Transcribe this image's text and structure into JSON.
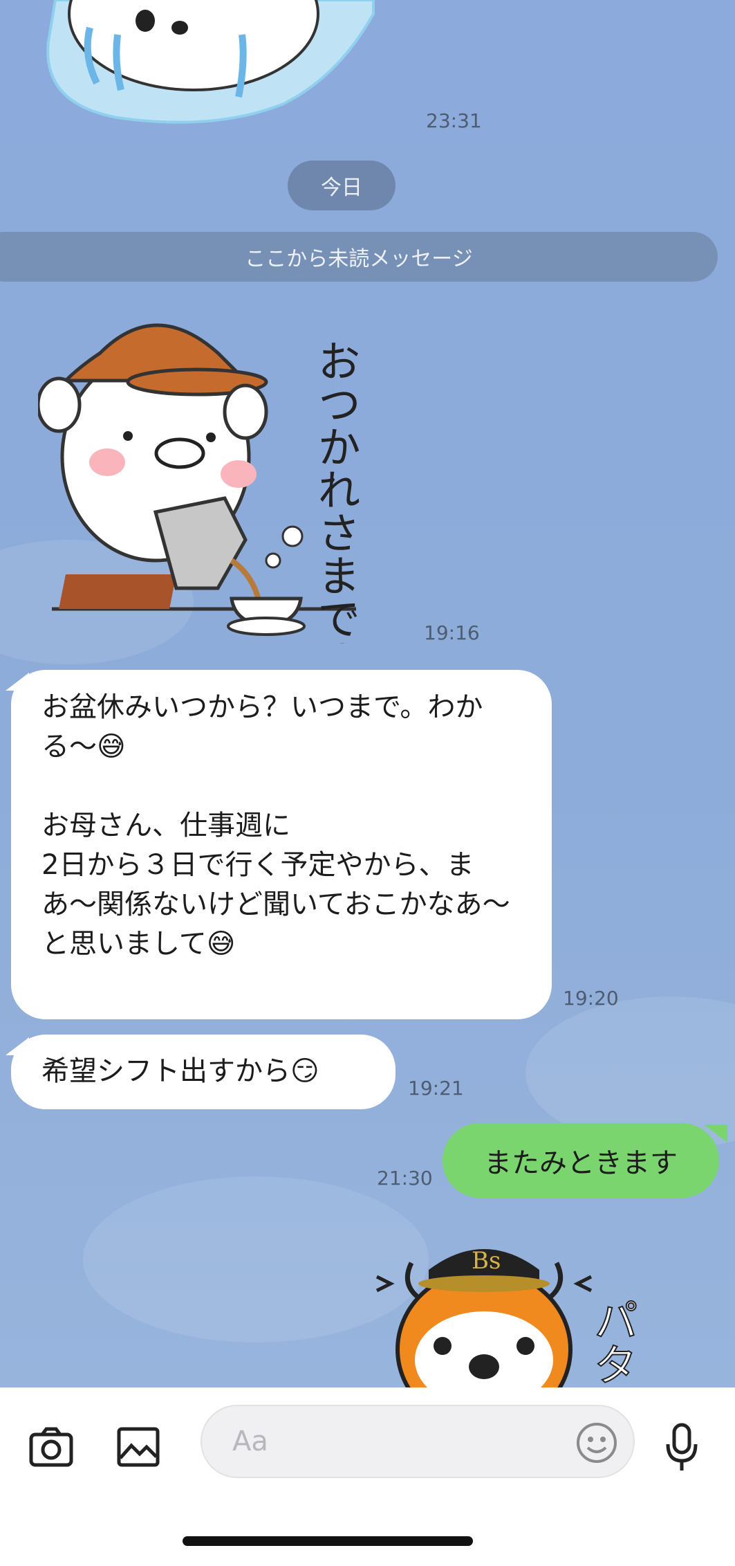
{
  "chat": {
    "top_time": "23:31",
    "date_divider": "今日",
    "unread_divider": "ここから未読メッセージ",
    "messages": [
      {
        "type": "sticker",
        "time": "19:16"
      },
      {
        "type": "text",
        "time": "19:20",
        "text": "お盆休みいつから？いつまで。わかる〜😅\n\nお母さん、仕事週に\n2日から３日で行く予定やから、まあ〜関係ないけど聞いておこかなあ〜と思いまして😅"
      },
      {
        "type": "text",
        "time": "19:21",
        "text": "希望シフト出すから😏"
      },
      {
        "type": "text",
        "time": "21:30",
        "text": "またみときます"
      },
      {
        "type": "sticker"
      }
    ],
    "sticker_text": {
      "otsukare": "おつかれさまです",
      "pata": "パタ",
      "cap": "Bs"
    }
  },
  "input_bar": {
    "placeholder": "Aa",
    "icons": [
      "camera-icon",
      "image-icon",
      "emoji-icon",
      "microphone-icon"
    ]
  },
  "colors": {
    "chat_background": "#8eacd9",
    "incoming_bubble": "#ffffff",
    "outgoing_bubble": "#7ad56f"
  }
}
